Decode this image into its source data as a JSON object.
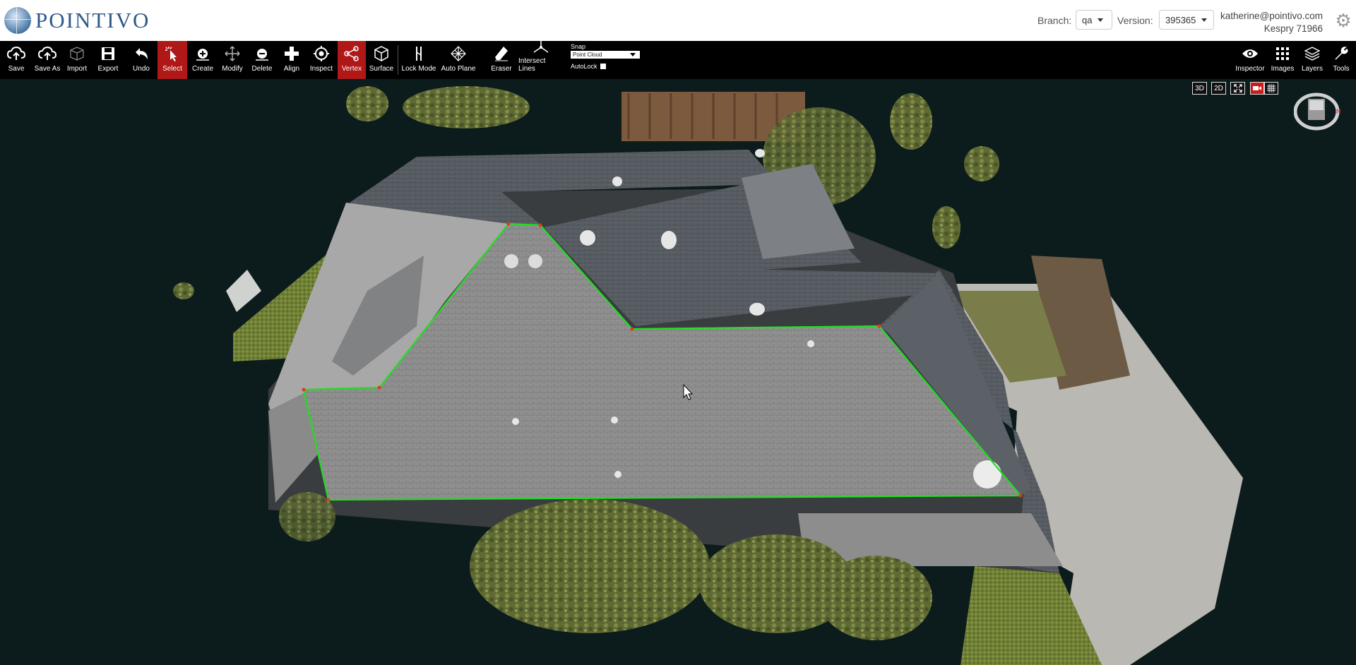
{
  "brand": {
    "name": "POINTIVO"
  },
  "header": {
    "branch_label": "Branch:",
    "branch_value": "qa",
    "version_label": "Version:",
    "version_value": "395365",
    "user_email": "katherine@pointivo.com",
    "project_name": "Kespry 71966"
  },
  "toolbar": {
    "items": [
      {
        "label": "Save",
        "icon": "cloud-upload-icon"
      },
      {
        "label": "Save As",
        "icon": "cloud-upload-icon"
      },
      {
        "label": "Import",
        "icon": "cube-icon"
      },
      {
        "label": "Export",
        "icon": "floppy-disk-icon"
      },
      {
        "label": "Undo",
        "icon": "undo-arrow-icon"
      },
      {
        "label": "Select",
        "icon": "cursor-icon",
        "active": true
      },
      {
        "label": "Create",
        "icon": "plus-circle-icon"
      },
      {
        "label": "Modify",
        "icon": "move-arrows-icon"
      },
      {
        "label": "Delete",
        "icon": "minus-circle-icon"
      },
      {
        "label": "Align",
        "icon": "align-icon"
      },
      {
        "label": "Inspect",
        "icon": "target-icon"
      },
      {
        "label": "Vertex",
        "icon": "vertex-nodes-icon",
        "active": true
      },
      {
        "label": "Surface",
        "icon": "surface-cube-icon"
      },
      {
        "label": "Lock Mode",
        "icon": "lock-lines-icon"
      },
      {
        "label": "Auto Plane",
        "icon": "plane-grid-icon"
      },
      {
        "label": "Eraser",
        "icon": "eraser-icon"
      },
      {
        "label": "Intersect Lines",
        "icon": "intersect-lines-icon"
      }
    ],
    "snap_label": "Snap",
    "snap_value": "Point Cloud",
    "autolock_label": "AutoLock",
    "right_items": [
      {
        "label": "Inspector",
        "icon": "eye-icon"
      },
      {
        "label": "Images",
        "icon": "grid-icon"
      },
      {
        "label": "Layers",
        "icon": "layers-icon"
      },
      {
        "label": "Tools",
        "icon": "wrench-icon"
      }
    ]
  },
  "viewport": {
    "view_buttons": [
      "3D",
      "2D"
    ],
    "accent_color": "#b01717",
    "outline_color": "#22dd22"
  }
}
